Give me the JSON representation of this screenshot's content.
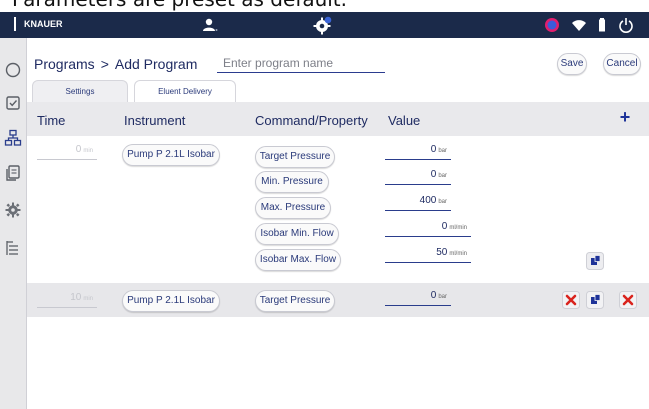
{
  "caption": {
    "text": "Parameters are preset as default."
  },
  "statusbar": {
    "brand": "KNAUER",
    "icons": [
      "user-icon",
      "gear-badge-icon",
      "network-icon",
      "wifi-icon",
      "battery-icon",
      "power-icon"
    ]
  },
  "sidebar": {
    "items": [
      {
        "name": "circle-icon"
      },
      {
        "name": "checkbox-icon"
      },
      {
        "name": "hierarchy-icon"
      },
      {
        "name": "copy-icon"
      },
      {
        "name": "gear-icon"
      },
      {
        "name": "list-icon"
      }
    ]
  },
  "header": {
    "breadcrumb_root": "Programs",
    "breadcrumb_sep": ">",
    "breadcrumb_current": "Add Program",
    "name_placeholder": "Enter program name",
    "save_label": "Save",
    "cancel_label": "Cancel"
  },
  "tabs": [
    {
      "label": "Settings",
      "active": false
    },
    {
      "label": "Eluent Delivery",
      "active": true
    }
  ],
  "table": {
    "columns": [
      "Time",
      "Instrument",
      "Command/Property",
      "Value"
    ],
    "rows": [
      {
        "time": "0",
        "time_unit": "min",
        "instrument": "Pump P 2.1L Isobar",
        "commands": [
          {
            "property": "Target Pressure",
            "value": "0",
            "unit": "bar"
          },
          {
            "property": "Min. Pressure",
            "value": "0",
            "unit": "bar"
          },
          {
            "property": "Max. Pressure",
            "value": "400",
            "unit": "bar"
          },
          {
            "property": "Isobar Min. Flow",
            "value": "0",
            "unit": "ml/min"
          },
          {
            "property": "Isobar Max. Flow",
            "value": "50",
            "unit": "ml/min"
          }
        ]
      },
      {
        "time": "10",
        "time_unit": "min",
        "instrument": "Pump P 2.1L Isobar",
        "commands": [
          {
            "property": "Target Pressure",
            "value": "0",
            "unit": "bar"
          }
        ]
      }
    ]
  },
  "colors": {
    "statusbar_bg": "#1b2a4a",
    "accent_blue": "#1e3399",
    "delete_red": "#d9231d"
  }
}
